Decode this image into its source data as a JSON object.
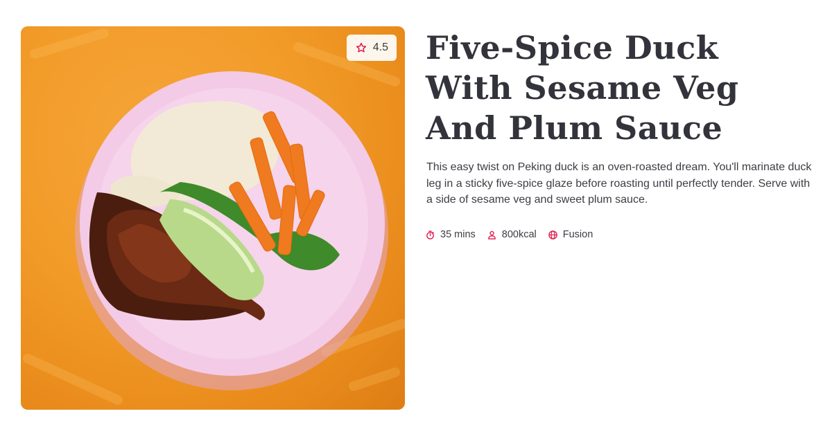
{
  "recipe": {
    "rating": "4.5",
    "title": "Five-Spice Duck With Sesame Veg And Plum Sauce",
    "description": "This easy twist on Peking duck is an oven-roasted dream. You'll marinate duck leg in a sticky five-spice glaze before roasting until perfectly tender. Serve with a side of sesame veg and sweet plum sauce.",
    "meta": {
      "time": "35 mins",
      "calories": "800kcal",
      "cuisine": "Fusion"
    }
  },
  "icons": {
    "rating": "star-icon",
    "time": "timer-icon",
    "calories": "person-icon",
    "cuisine": "globe-icon"
  },
  "colors": {
    "accent": "#e0194d",
    "photo_background": "#f19a27",
    "plate": "#f3c8e6"
  }
}
